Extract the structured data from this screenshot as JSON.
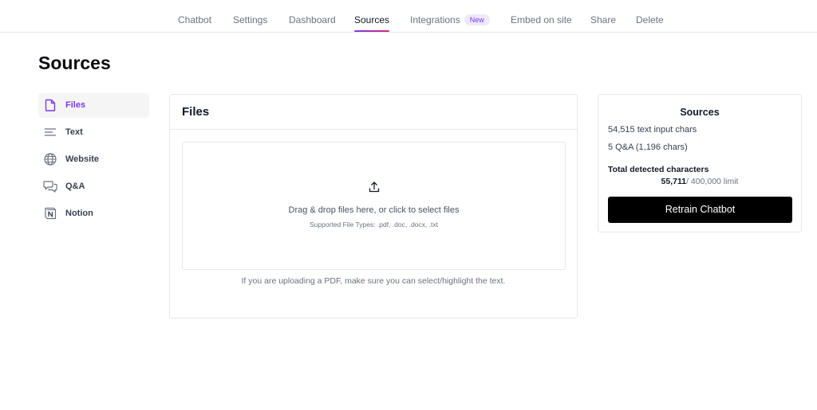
{
  "nav": {
    "tabs": [
      {
        "label": "Chatbot"
      },
      {
        "label": "Settings"
      },
      {
        "label": "Dashboard"
      },
      {
        "label": "Sources"
      },
      {
        "label": "Integrations",
        "badge": "New"
      },
      {
        "label": "Embed on site"
      },
      {
        "label": "Share"
      },
      {
        "label": "Delete"
      }
    ],
    "active_tab": "Sources",
    "accent_color": "#7c3aed"
  },
  "page": {
    "title": "Sources"
  },
  "sidebar": {
    "items": [
      {
        "label": "Files",
        "icon": "file-icon",
        "active": true
      },
      {
        "label": "Text",
        "icon": "text-lines-icon"
      },
      {
        "label": "Website",
        "icon": "globe-icon"
      },
      {
        "label": "Q&A",
        "icon": "chat-bubbles-icon"
      },
      {
        "label": "Notion",
        "icon": "notion-icon"
      }
    ]
  },
  "files_card": {
    "title": "Files",
    "dropzone_text": "Drag & drop files here, or click to select files",
    "supported_types": "Supported File Types: .pdf, .doc, .docx, .txt",
    "pdf_note": "If you are uploading a PDF, make sure you can select/highlight the text."
  },
  "summary": {
    "title": "Sources",
    "text_chars": "54,515 text input chars",
    "qa_chars": "5 Q&A (1,196 chars)",
    "total_label": "Total detected characters",
    "total_value": "55,711",
    "limit": "/ 400,000 limit",
    "retrain_label": "Retrain Chatbot"
  }
}
